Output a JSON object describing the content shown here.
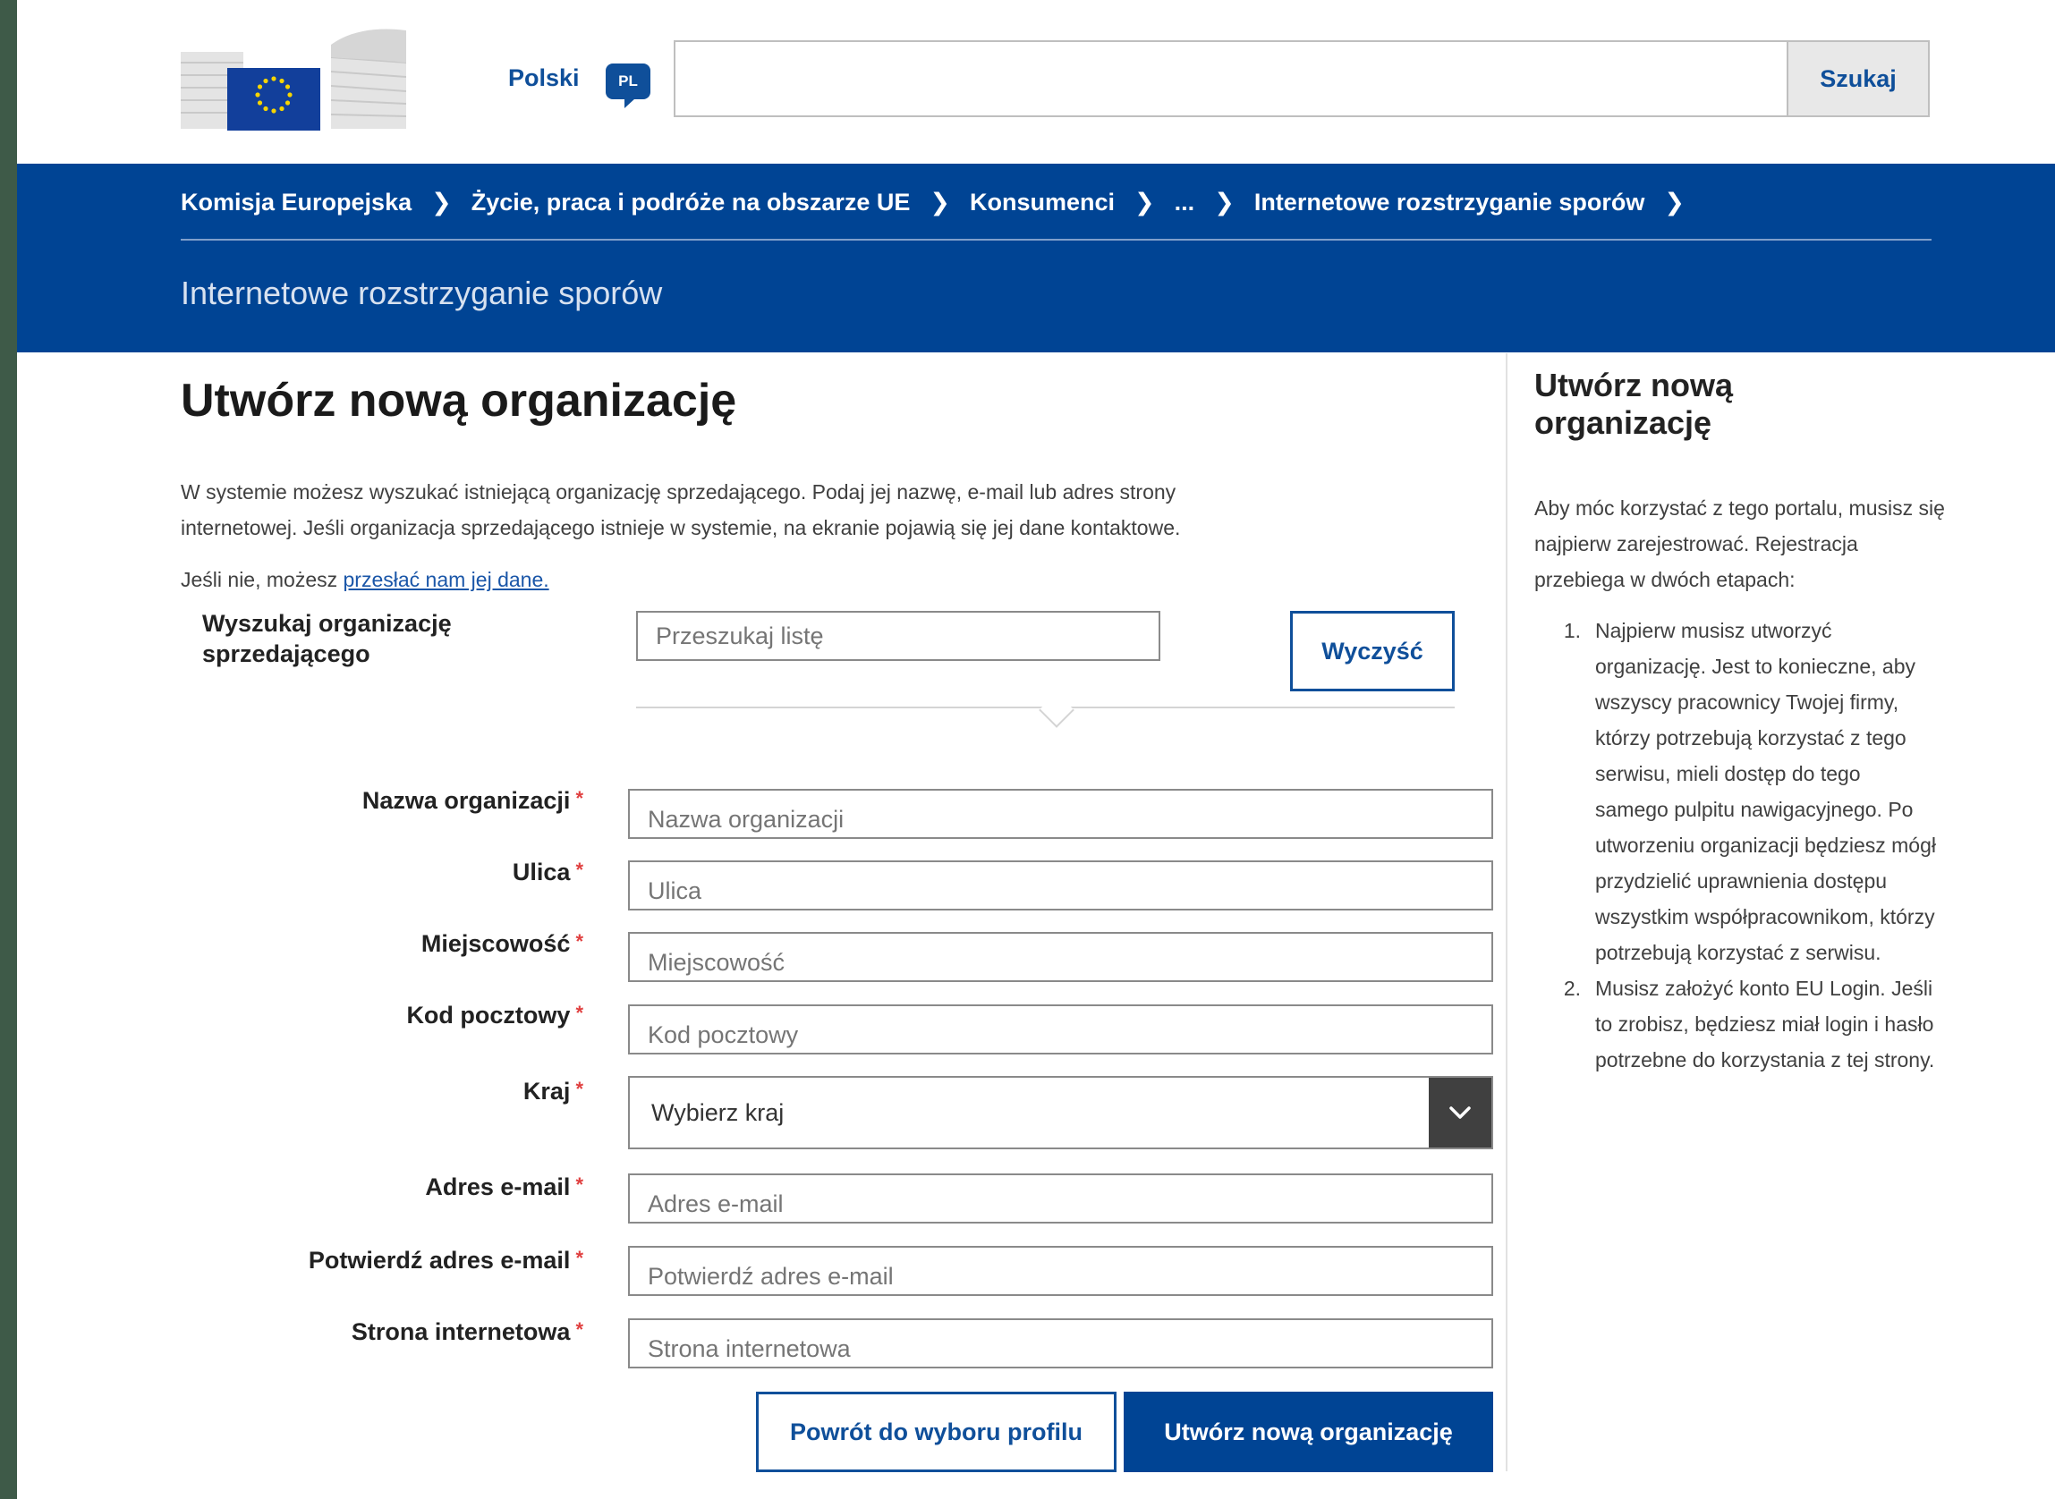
{
  "header": {
    "language_label": "Polski",
    "language_code": "PL",
    "search_placeholder": "",
    "search_button": "Szukaj"
  },
  "breadcrumb": [
    "Komisja Europejska",
    "Życie, praca i podróże na obszarze UE",
    "Konsumenci",
    "...",
    "Internetowe rozstrzyganie sporów"
  ],
  "band_title": "Internetowe rozstrzyganie sporów",
  "main": {
    "title": "Utwórz nową organizację",
    "intro": "W systemie możesz wyszukać istniejącą organizację sprzedającego. Podaj jej nazwę, e-mail lub adres strony internetowej. Jeśli organizacja sprzedającego istnieje w systemie, na ekranie pojawią się jej dane kontaktowe.",
    "intro2_prefix": "Jeśli nie, możesz ",
    "intro2_link": "przesłać nam jej dane.",
    "search_org_label": "Wyszukaj organizację sprzedającego",
    "search_org_placeholder": "Przeszukaj listę",
    "clear_button": "Wyczyść",
    "required_mark": "*",
    "fields": {
      "name": {
        "label": "Nazwa organizacji",
        "placeholder": "Nazwa organizacji"
      },
      "street": {
        "label": "Ulica",
        "placeholder": "Ulica"
      },
      "city": {
        "label": "Miejscowość",
        "placeholder": "Miejscowość"
      },
      "postcode": {
        "label": "Kod pocztowy",
        "placeholder": "Kod pocztowy"
      },
      "country": {
        "label": "Kraj",
        "value": "Wybierz kraj"
      },
      "email": {
        "label": "Adres e-mail",
        "placeholder": "Adres e-mail"
      },
      "email_confirm": {
        "label": "Potwierdź adres e-mail",
        "placeholder": "Potwierdź adres e-mail"
      },
      "website": {
        "label": "Strona internetowa",
        "placeholder": "Strona internetowa"
      }
    },
    "back_button": "Powrót do wyboru profilu",
    "create_button": "Utwórz nową organizację"
  },
  "sidebar": {
    "title": "Utwórz nową organizację",
    "intro": "Aby móc korzystać z tego portalu, musisz się najpierw zarejestrować. Rejestracja przebiega w dwóch etapach:",
    "steps": [
      {
        "num": "1.",
        "text": "Najpierw musisz utworzyć organizację. Jest to konieczne, aby wszyscy pracownicy Twojej firmy, którzy potrzebują korzystać z tego serwisu, mieli dostęp do tego samego pulpitu nawigacyjnego. Po utworzeniu organizacji będziesz mógł przydzielić uprawnienia dostępu wszystkim współpracownikom, którzy potrzebują korzystać z serwisu."
      },
      {
        "num": "2.",
        "text": "Musisz założyć konto EU Login. Jeśli to zrobisz, będziesz miał login i hasło potrzebne do korzystania z tej strony."
      }
    ]
  },
  "colors": {
    "brand_blue": "#004494",
    "link_blue": "#0f4f9a",
    "required_red": "#e04040"
  },
  "icons": [
    "eu-commission-logo-icon",
    "speech-bubble-icon",
    "chevron-right-icon",
    "chevron-down-icon"
  ]
}
